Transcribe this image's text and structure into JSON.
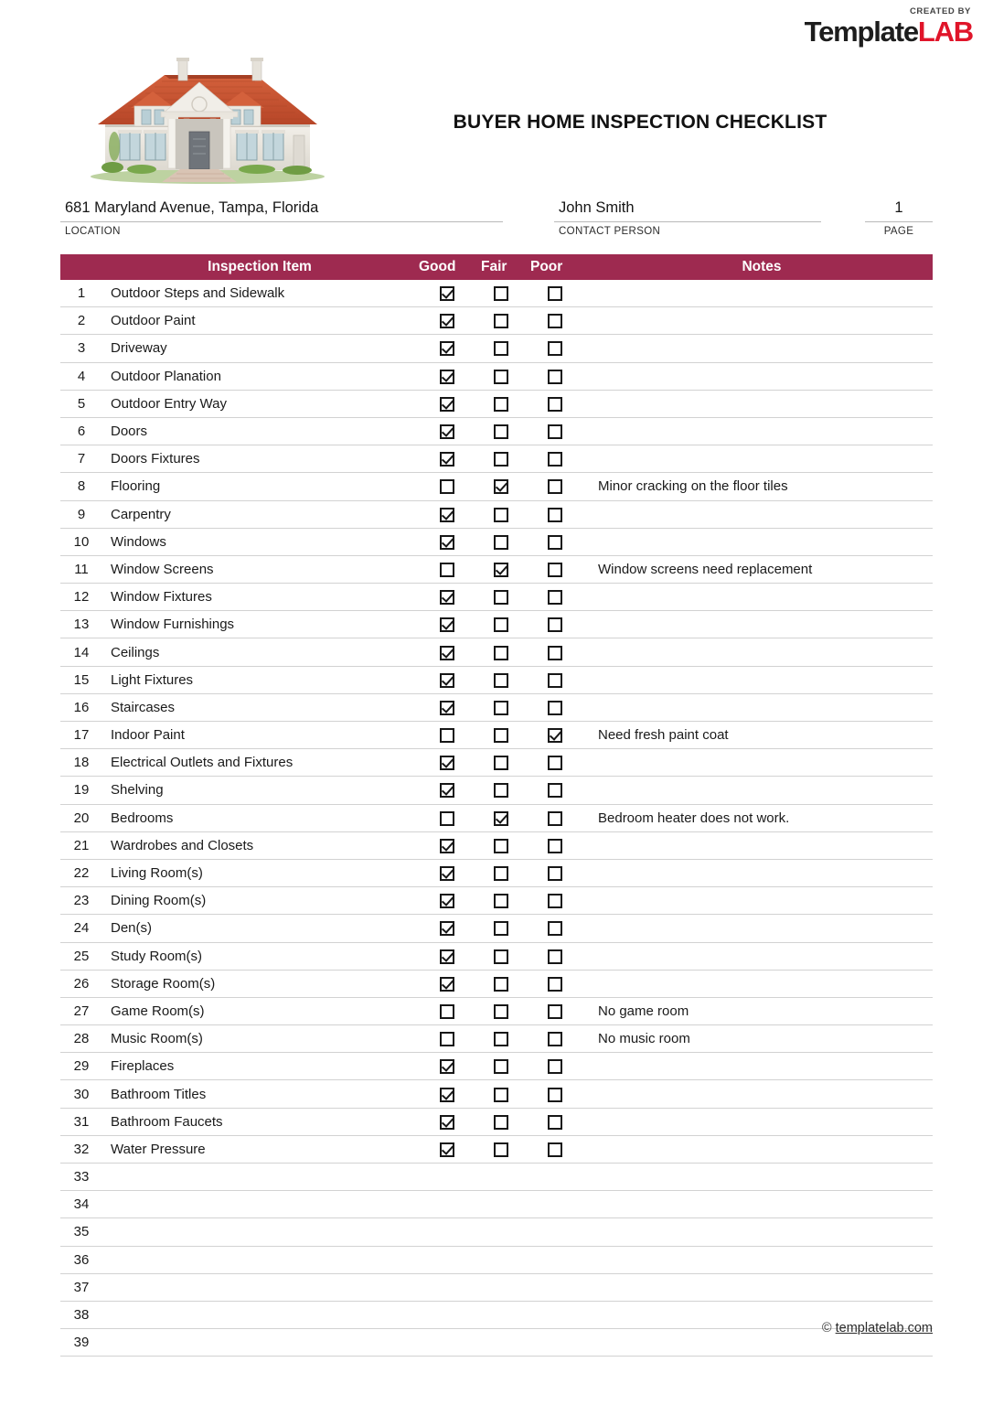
{
  "brand": {
    "created_by": "CREATED BY",
    "name_part1": "Template",
    "name_part2": "LAB",
    "accent_color": "#e0152a"
  },
  "header": {
    "title": "BUYER HOME INSPECTION CHECKLIST"
  },
  "meta": {
    "location": {
      "value": "681  Maryland Avenue, Tampa, Florida",
      "label": "LOCATION"
    },
    "contact": {
      "value": "John Smith",
      "label": "CONTACT PERSON"
    },
    "page": {
      "value": "1",
      "label": "PAGE"
    }
  },
  "table": {
    "accent_color": "#9e2a50",
    "columns": {
      "number": "",
      "item": "Inspection Item",
      "good": "Good",
      "fair": "Fair",
      "poor": "Poor",
      "notes": "Notes"
    },
    "rows": [
      {
        "num": "1",
        "item": "Outdoor Steps and Sidewalk",
        "good": true,
        "fair": false,
        "poor": false,
        "notes": ""
      },
      {
        "num": "2",
        "item": "Outdoor Paint",
        "good": true,
        "fair": false,
        "poor": false,
        "notes": ""
      },
      {
        "num": "3",
        "item": "Driveway",
        "good": true,
        "fair": false,
        "poor": false,
        "notes": ""
      },
      {
        "num": "4",
        "item": "Outdoor Planation",
        "good": true,
        "fair": false,
        "poor": false,
        "notes": ""
      },
      {
        "num": "5",
        "item": "Outdoor Entry Way",
        "good": true,
        "fair": false,
        "poor": false,
        "notes": ""
      },
      {
        "num": "6",
        "item": "Doors",
        "good": true,
        "fair": false,
        "poor": false,
        "notes": ""
      },
      {
        "num": "7",
        "item": "Doors Fixtures",
        "good": true,
        "fair": false,
        "poor": false,
        "notes": ""
      },
      {
        "num": "8",
        "item": "Flooring",
        "good": false,
        "fair": true,
        "poor": false,
        "notes": "Minor cracking on the floor tiles"
      },
      {
        "num": "9",
        "item": "Carpentry",
        "good": true,
        "fair": false,
        "poor": false,
        "notes": ""
      },
      {
        "num": "10",
        "item": "Windows",
        "good": true,
        "fair": false,
        "poor": false,
        "notes": ""
      },
      {
        "num": "11",
        "item": "Window Screens",
        "good": false,
        "fair": true,
        "poor": false,
        "notes": "Window screens need replacement"
      },
      {
        "num": "12",
        "item": "Window Fixtures",
        "good": true,
        "fair": false,
        "poor": false,
        "notes": ""
      },
      {
        "num": "13",
        "item": "Window Furnishings",
        "good": true,
        "fair": false,
        "poor": false,
        "notes": ""
      },
      {
        "num": "14",
        "item": "Ceilings",
        "good": true,
        "fair": false,
        "poor": false,
        "notes": ""
      },
      {
        "num": "15",
        "item": "Light Fixtures",
        "good": true,
        "fair": false,
        "poor": false,
        "notes": ""
      },
      {
        "num": "16",
        "item": "Staircases",
        "good": true,
        "fair": false,
        "poor": false,
        "notes": ""
      },
      {
        "num": "17",
        "item": "Indoor Paint",
        "good": false,
        "fair": false,
        "poor": true,
        "notes": "Need fresh paint coat"
      },
      {
        "num": "18",
        "item": "Electrical Outlets and Fixtures",
        "good": true,
        "fair": false,
        "poor": false,
        "notes": ""
      },
      {
        "num": "19",
        "item": "Shelving",
        "good": true,
        "fair": false,
        "poor": false,
        "notes": ""
      },
      {
        "num": "20",
        "item": "Bedrooms",
        "good": false,
        "fair": true,
        "poor": false,
        "notes": "Bedroom heater does not work."
      },
      {
        "num": "21",
        "item": "Wardrobes and Closets",
        "good": true,
        "fair": false,
        "poor": false,
        "notes": ""
      },
      {
        "num": "22",
        "item": "Living Room(s)",
        "good": true,
        "fair": false,
        "poor": false,
        "notes": ""
      },
      {
        "num": "23",
        "item": "Dining Room(s)",
        "good": true,
        "fair": false,
        "poor": false,
        "notes": ""
      },
      {
        "num": "24",
        "item": "Den(s)",
        "good": true,
        "fair": false,
        "poor": false,
        "notes": ""
      },
      {
        "num": "25",
        "item": "Study Room(s)",
        "good": true,
        "fair": false,
        "poor": false,
        "notes": ""
      },
      {
        "num": "26",
        "item": "Storage Room(s)",
        "good": true,
        "fair": false,
        "poor": false,
        "notes": ""
      },
      {
        "num": "27",
        "item": "Game Room(s)",
        "good": false,
        "fair": false,
        "poor": false,
        "notes": "No game room"
      },
      {
        "num": "28",
        "item": "Music Room(s)",
        "good": false,
        "fair": false,
        "poor": false,
        "notes": "No music room"
      },
      {
        "num": "29",
        "item": "Fireplaces",
        "good": true,
        "fair": false,
        "poor": false,
        "notes": ""
      },
      {
        "num": "30",
        "item": "Bathroom Titles",
        "good": true,
        "fair": false,
        "poor": false,
        "notes": ""
      },
      {
        "num": "31",
        "item": "Bathroom Faucets",
        "good": true,
        "fair": false,
        "poor": false,
        "notes": ""
      },
      {
        "num": "32",
        "item": "Water Pressure",
        "good": true,
        "fair": false,
        "poor": false,
        "notes": ""
      },
      {
        "num": "33",
        "item": "",
        "good": null,
        "fair": null,
        "poor": null,
        "notes": ""
      },
      {
        "num": "34",
        "item": "",
        "good": null,
        "fair": null,
        "poor": null,
        "notes": ""
      },
      {
        "num": "35",
        "item": "",
        "good": null,
        "fair": null,
        "poor": null,
        "notes": ""
      },
      {
        "num": "36",
        "item": "",
        "good": null,
        "fair": null,
        "poor": null,
        "notes": ""
      },
      {
        "num": "37",
        "item": "",
        "good": null,
        "fair": null,
        "poor": null,
        "notes": ""
      },
      {
        "num": "38",
        "item": "",
        "good": null,
        "fair": null,
        "poor": null,
        "notes": ""
      },
      {
        "num": "39",
        "item": "",
        "good": null,
        "fair": null,
        "poor": null,
        "notes": ""
      }
    ]
  },
  "footer": {
    "copyright_symbol": "©",
    "site": "templatelab.com"
  },
  "house_image": {
    "alt": "two-story house with tile roof and columned portico",
    "roof_color": "#c8502f",
    "wall_color": "#e8e5de",
    "grass_color": "#7aa94a"
  }
}
